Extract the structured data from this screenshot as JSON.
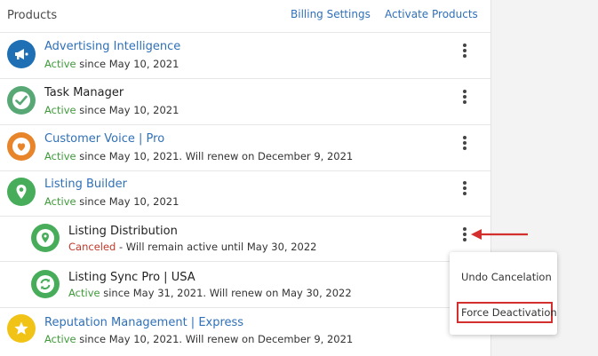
{
  "header": {
    "title": "Products",
    "billing_settings": "Billing Settings",
    "activate_products": "Activate Products"
  },
  "colors": {
    "link": "#2f70b8",
    "active": "#3f9a3a",
    "canceled": "#c0392b",
    "highlight": "#d32f2f"
  },
  "products": [
    {
      "name": "Advertising Intelligence",
      "status": "Active",
      "detail": " since May 10, 2021",
      "icon": "megaphone-icon",
      "icon_color": "#1f6fb5"
    },
    {
      "name": "Task Manager",
      "status": "Active",
      "detail": " since May 10, 2021",
      "icon": "checkmark-icon",
      "icon_color": "#58a876"
    },
    {
      "name": "Customer Voice | Pro",
      "status": "Active",
      "detail": " since May 10, 2021. Will renew on December 9, 2021",
      "icon": "heart-icon",
      "icon_color": "#e8852b"
    },
    {
      "name": "Listing Builder",
      "status": "Active",
      "detail": " since May 10, 2021",
      "icon": "location-pin-icon",
      "icon_color": "#47ad5a"
    },
    {
      "name": "Listing Distribution",
      "status": "Canceled",
      "detail": " - Will remain active until May 30, 2022",
      "icon": "distribution-icon",
      "icon_color": "#47ad5a"
    },
    {
      "name": "Listing Sync Pro | USA",
      "status": "Active",
      "detail": " since May 31, 2021. Will renew on May 30, 2022",
      "icon": "sync-icon",
      "icon_color": "#47ad5a"
    },
    {
      "name": "Reputation Management | Express",
      "status": "Active",
      "detail": " since May 10, 2021. Will renew on December 9, 2021",
      "icon": "star-icon",
      "icon_color": "#f2c317"
    }
  ],
  "menu": {
    "undo_cancelation": "Undo Cancelation",
    "force_deactivation": "Force Deactivation"
  }
}
